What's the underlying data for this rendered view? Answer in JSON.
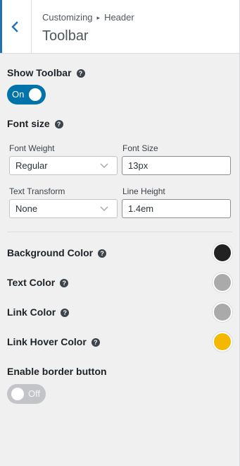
{
  "header": {
    "breadcrumb_root": "Customizing",
    "breadcrumb_separator": "▸",
    "breadcrumb_section": "Header",
    "title": "Toolbar"
  },
  "show_toolbar": {
    "label": "Show Toolbar",
    "help": "?",
    "toggle_text": "On",
    "state": "on"
  },
  "font_size_section": {
    "label": "Font size",
    "help": "?"
  },
  "font_weight": {
    "label": "Font Weight",
    "value": "Regular"
  },
  "font_size": {
    "label": "Font Size",
    "value": "13px"
  },
  "text_transform": {
    "label": "Text Transform",
    "value": "None"
  },
  "line_height": {
    "label": "Line Height",
    "value": "1.4em"
  },
  "colors": [
    {
      "label": "Background Color",
      "help": "?",
      "color": "#222222"
    },
    {
      "label": "Text Color",
      "help": "?",
      "color": "#aaaaaa"
    },
    {
      "label": "Link Color",
      "help": "?",
      "color": "#aaaaaa"
    },
    {
      "label": "Link Hover Color",
      "help": "?",
      "color": "#f5b800"
    }
  ],
  "border_button": {
    "label": "Enable border button",
    "toggle_text": "Off",
    "state": "off"
  },
  "accent_color": "#0073aa"
}
